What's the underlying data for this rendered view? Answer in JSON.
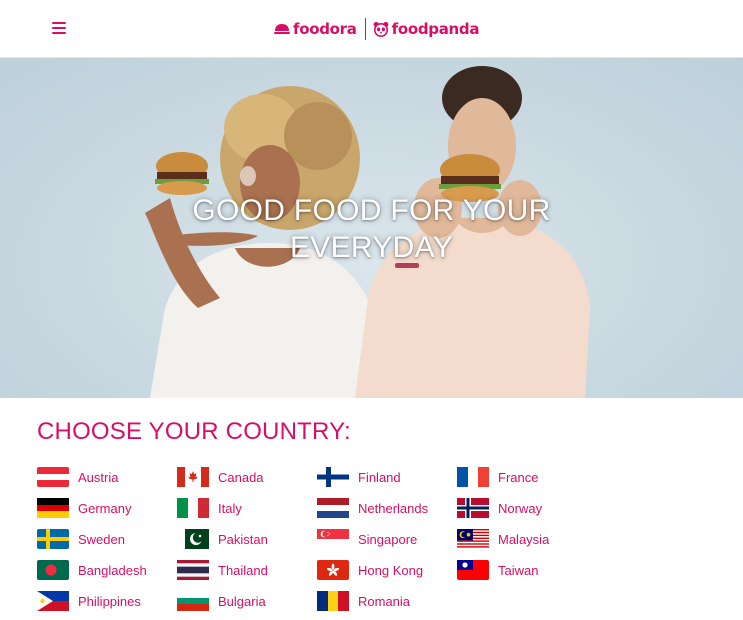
{
  "header": {
    "brand_left": "foodora",
    "brand_right": "foodpanda",
    "brand_color": "#d70f64"
  },
  "hero": {
    "title_line1": "GOOD FOOD FOR YOUR",
    "title_line2": "EVERYDAY"
  },
  "countries_section": {
    "title": "CHOOSE YOUR COUNTRY:",
    "countries": [
      {
        "name": "Austria",
        "flag": "austria-flag-icon"
      },
      {
        "name": "Canada",
        "flag": "canada-flag-icon"
      },
      {
        "name": "Finland",
        "flag": "finland-flag-icon"
      },
      {
        "name": "France",
        "flag": "france-flag-icon"
      },
      {
        "name": "Germany",
        "flag": "germany-flag-icon"
      },
      {
        "name": "Italy",
        "flag": "italy-flag-icon"
      },
      {
        "name": "Netherlands",
        "flag": "netherlands-flag-icon"
      },
      {
        "name": "Norway",
        "flag": "norway-flag-icon"
      },
      {
        "name": "Sweden",
        "flag": "sweden-flag-icon"
      },
      {
        "name": "Pakistan",
        "flag": "pakistan-flag-icon"
      },
      {
        "name": "Singapore",
        "flag": "singapore-flag-icon"
      },
      {
        "name": "Malaysia",
        "flag": "malaysia-flag-icon"
      },
      {
        "name": "Bangladesh",
        "flag": "bangladesh-flag-icon"
      },
      {
        "name": "Thailand",
        "flag": "thailand-flag-icon"
      },
      {
        "name": "Hong Kong",
        "flag": "hong-kong-flag-icon"
      },
      {
        "name": "Taiwan",
        "flag": "taiwan-flag-icon"
      },
      {
        "name": "Philippines",
        "flag": "philippines-flag-icon"
      },
      {
        "name": "Bulgaria",
        "flag": "bulgaria-flag-icon"
      },
      {
        "name": "Romania",
        "flag": "romania-flag-icon"
      }
    ]
  }
}
